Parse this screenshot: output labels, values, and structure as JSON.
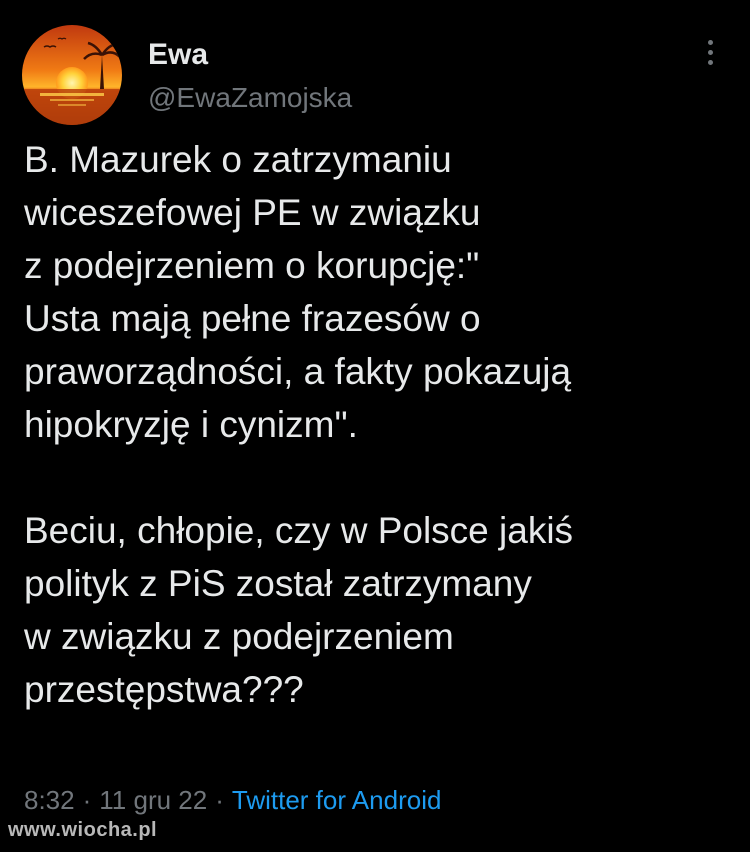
{
  "user": {
    "display_name": "Ewa",
    "handle": "@EwaZamojska"
  },
  "avatar": {
    "icon": "sunset-avatar-icon"
  },
  "tweet": {
    "text": "B. Mazurek o zatrzymaniu\nwiceszefowej PE w związku\nz podejrzeniem o korupcję:\"\nUsta mają pełne frazesów o\npraworządności, a fakty pokazują\nhipokryzję i cynizm\".\n\nBeciu, chłopie, czy w Polsce jakiś\npolityk z PiS został zatrzymany\nw związku z podejrzeniem\nprzestępstwa???"
  },
  "meta": {
    "time": "8:32",
    "separator": "·",
    "date": "11 gru 22",
    "source": "Twitter for Android"
  },
  "watermark": "www.wiocha.pl",
  "colors": {
    "background": "#000000",
    "text": "#e7e9ea",
    "muted": "#71767b",
    "link": "#1d9bf0"
  }
}
